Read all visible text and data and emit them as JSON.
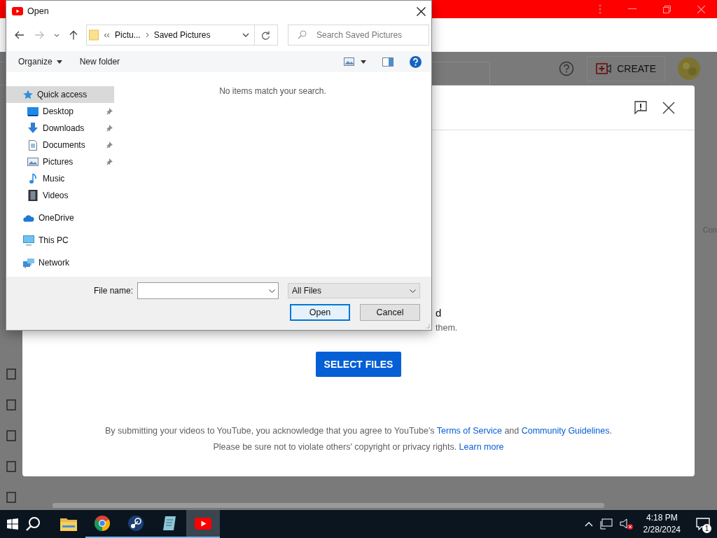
{
  "studio_header": {
    "create_button": "CREATE"
  },
  "upload_dialog": {
    "partial_lines": [
      "d",
      "them."
    ],
    "select_button": "SELECT FILES",
    "terms": [
      {
        "kind": "text",
        "text": "By submitting your videos to YouTube, you acknowledge that you agree to YouTube's "
      },
      {
        "kind": "link",
        "text": "Terms of Service"
      },
      {
        "kind": "text",
        "text": " and "
      },
      {
        "kind": "link",
        "text": "Community Guidelines"
      },
      {
        "kind": "text",
        "text": "."
      }
    ],
    "privacy": [
      {
        "kind": "text",
        "text": "Please be sure not to violate others' copyright or privacy rights. "
      },
      {
        "kind": "link",
        "text": "Learn more"
      }
    ]
  },
  "side_text": "Con",
  "open_dialog": {
    "title": "Open",
    "breadcrumb": [
      "Pictu...",
      "Saved Pictures"
    ],
    "search": {
      "placeholder": "Search Saved Pictures"
    },
    "toolbar": {
      "organize": "Organize",
      "new_folder": "New folder"
    },
    "empty_message": "No items match your search.",
    "nav": [
      {
        "label": "Quick access",
        "selected": true,
        "children": [
          {
            "label": "Desktop",
            "pinned": true
          },
          {
            "label": "Downloads",
            "pinned": true
          },
          {
            "label": "Documents",
            "pinned": true
          },
          {
            "label": "Pictures",
            "pinned": true
          },
          {
            "label": "Music",
            "pinned": false
          },
          {
            "label": "Videos",
            "pinned": false
          }
        ]
      },
      {
        "label": "OneDrive",
        "selected": false
      },
      {
        "label": "This PC",
        "selected": false
      },
      {
        "label": "Network",
        "selected": false
      }
    ],
    "file_name_label": "File name:",
    "file_type": "All Files",
    "buttons": [
      {
        "label": "Open",
        "default": true
      },
      {
        "label": "Cancel",
        "default": false
      }
    ]
  },
  "taskbar": {
    "apps": [
      {
        "running": false,
        "selected": false
      },
      {
        "running": true,
        "selected": false
      },
      {
        "running": true,
        "selected": false
      },
      {
        "running": true,
        "selected": false
      },
      {
        "running": true,
        "selected": true
      }
    ],
    "time": "4:18 PM",
    "date": "2/28/2024",
    "notification_count": "1"
  }
}
